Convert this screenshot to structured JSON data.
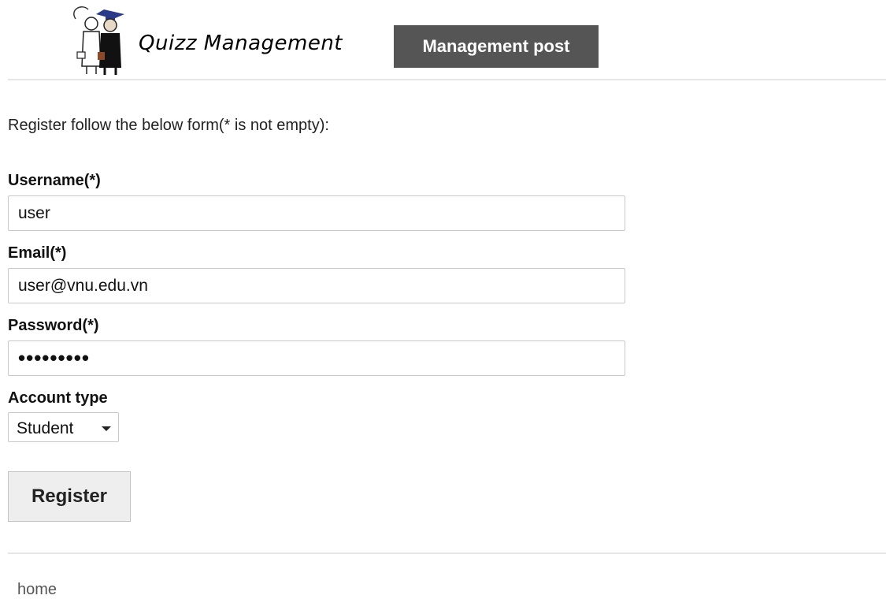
{
  "header": {
    "app_title": "Quizz Management",
    "nav_button_label": "Management post"
  },
  "form": {
    "intro": "Register follow the below form(* is not empty):",
    "username": {
      "label": "Username(*)",
      "value": "user"
    },
    "email": {
      "label": "Email(*)",
      "value": "user@vnu.edu.vn"
    },
    "password": {
      "label": "Password(*)",
      "value": "•••••••••"
    },
    "account_type": {
      "label": "Account type",
      "selected": "Student"
    },
    "submit_label": "Register"
  },
  "footer": {
    "home_label": "home"
  },
  "colors": {
    "nav_button_bg": "#555555",
    "nav_button_text": "#ffffff",
    "register_button_bg": "#eeeeee",
    "divider": "#e6e6e6"
  },
  "icons": {
    "logo": "graduates-logo-icon",
    "select_arrow": "caret-down-icon"
  }
}
